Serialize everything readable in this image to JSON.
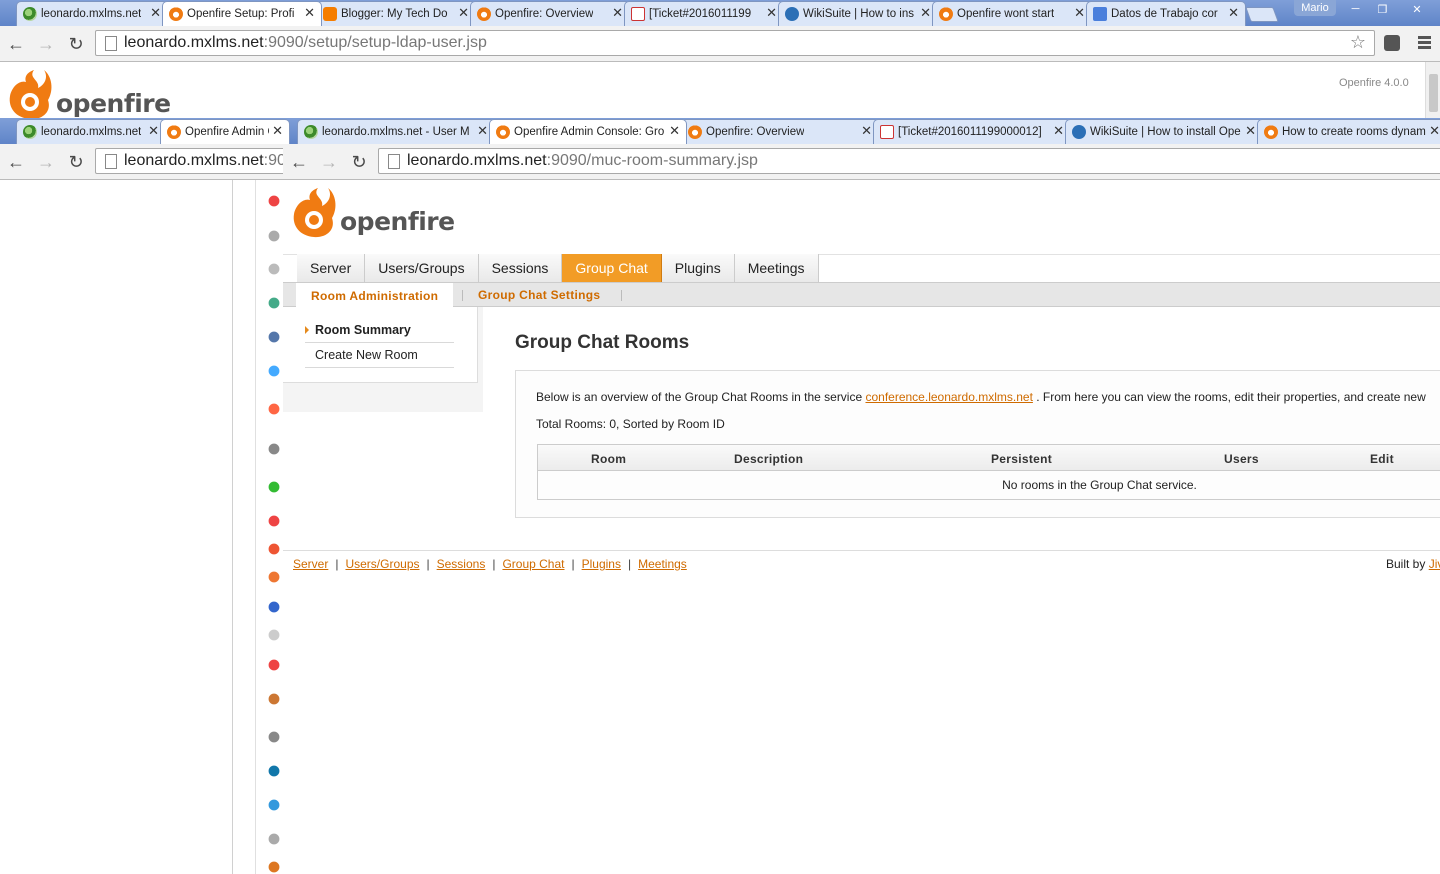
{
  "back_window": {
    "tabs": [
      {
        "title": "leonardo.mxlms.net",
        "icon": "rss-icon",
        "active": false
      },
      {
        "title": "Openfire Setup: Profi",
        "icon": "openfire-icon",
        "active": true
      },
      {
        "title": "Blogger: My Tech Do",
        "icon": "blogger-icon",
        "active": false
      },
      {
        "title": "Openfire: Overview",
        "icon": "openfire-icon",
        "active": false
      },
      {
        "title": "[Ticket#2016011199",
        "icon": "gmail-icon",
        "active": false
      },
      {
        "title": "WikiSuite | How to ins",
        "icon": "wiki-icon",
        "active": false
      },
      {
        "title": "Openfire wont start",
        "icon": "openfire-icon",
        "active": false
      },
      {
        "title": "Datos de Trabajo cor",
        "icon": "docs-icon",
        "active": false
      }
    ],
    "user_badge": "Mario",
    "url_host": "leonardo.mxlms.net",
    "url_path": ":9090/setup/setup-ldap-user.jsp",
    "logo_text": "openfire",
    "version": "Openfire 4.0.0"
  },
  "middle_window": {
    "tabs": [
      {
        "title": "leonardo.mxlms.net",
        "icon": "rss-icon",
        "active": false
      },
      {
        "title": "Openfire Admin Co",
        "icon": "openfire-icon",
        "active": true
      }
    ],
    "url_host": "leonardo.mxlms.net",
    "url_path": ":90"
  },
  "front_window": {
    "tabs": [
      {
        "title": "leonardo.mxlms.net - User M",
        "icon": "rss-icon",
        "active": false
      },
      {
        "title": "Openfire Admin Console: Gro",
        "icon": "openfire-icon",
        "active": true
      },
      {
        "title": "Openfire: Overview",
        "icon": "openfire-icon",
        "active": false
      },
      {
        "title": "[Ticket#2016011199000012]",
        "icon": "gmail-icon",
        "active": false
      },
      {
        "title": "WikiSuite | How to install Ope",
        "icon": "wiki-icon",
        "active": false
      },
      {
        "title": "How to create rooms dynamic",
        "icon": "openfire-icon",
        "active": false
      }
    ],
    "url_host": "leonardo.mxlms.net",
    "url_path": ":9090/muc-room-summary.jsp"
  },
  "console": {
    "logo_text": "openfire",
    "main_tabs": [
      "Server",
      "Users/Groups",
      "Sessions",
      "Group Chat",
      "Plugins",
      "Meetings"
    ],
    "active_main_tab": "Group Chat",
    "sub_tabs": [
      "Room Administration",
      "Group Chat Settings"
    ],
    "side_nav": [
      "Room Summary",
      "Create New Room"
    ],
    "page_title": "Group Chat Rooms",
    "intro_before": "Below is an overview of the Group Chat Rooms in the service ",
    "intro_link": "conference.leonardo.mxlms.net",
    "intro_after": " . From here you can view the rooms, edit their properties, and create new",
    "total_text": "Total Rooms: 0, Sorted by Room ID",
    "table_headers": [
      "Room",
      "Description",
      "Persistent",
      "Users",
      "Edit"
    ],
    "empty_text": "No rooms in the Group Chat service.",
    "footer_links": [
      "Server",
      "Users/Groups",
      "Sessions",
      "Group Chat",
      "Plugins",
      "Meetings"
    ],
    "built_by_label": "Built by ",
    "built_by_link": "Jiv"
  },
  "colors": {
    "accent": "#f29c26",
    "link": "#cf6b00",
    "tab_bg": "#dbe6f8",
    "titlebar": "#6d8fcf"
  }
}
